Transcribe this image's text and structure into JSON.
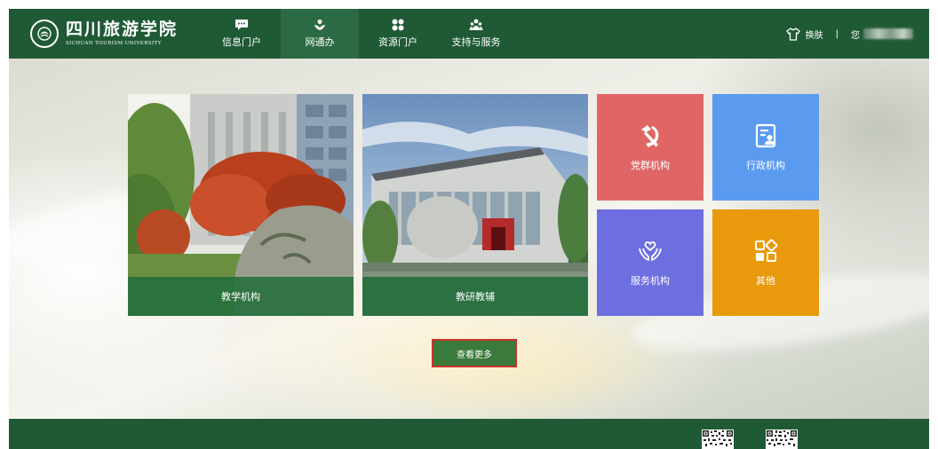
{
  "header": {
    "logo": {
      "name_cn": "四川旅游学院",
      "name_en": "SICHUAN TOURISM UNIVERSITY"
    },
    "nav": [
      {
        "label": "信息门户",
        "icon": "chat-icon",
        "active": false
      },
      {
        "label": "网通办",
        "icon": "flower-hand-icon",
        "active": true
      },
      {
        "label": "资源门户",
        "icon": "grid-icon",
        "active": false
      },
      {
        "label": "支持与服务",
        "icon": "people-icon",
        "active": false
      }
    ],
    "skin_label": "换肤",
    "separator": "|",
    "greeting": "您"
  },
  "tiles": [
    {
      "label": "教学机构",
      "type": "photo"
    },
    {
      "label": "教研教辅",
      "type": "photo"
    },
    {
      "label": "党群机构",
      "icon": "hammer-sickle-icon",
      "color": "#e06666"
    },
    {
      "label": "行政机构",
      "icon": "document-person-icon",
      "color": "#5b9bef"
    },
    {
      "label": "服务机构",
      "icon": "hands-heart-icon",
      "color": "#6d6ee0"
    },
    {
      "label": "其他",
      "icon": "blocks-icon",
      "color": "#e89a0c"
    }
  ],
  "more_button": "查看更多",
  "colors": {
    "brand_green": "#1f5a35",
    "caption_green": "#236e3c",
    "button_border": "#c9302c"
  }
}
